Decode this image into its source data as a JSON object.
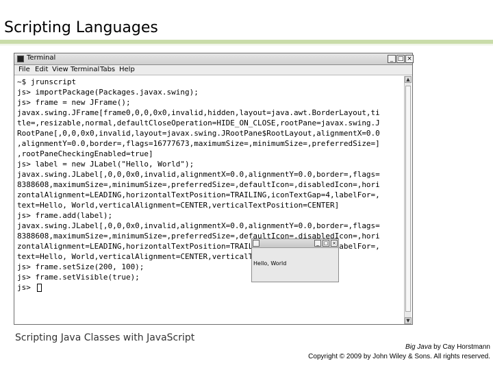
{
  "slide": {
    "title": "Scripting Languages",
    "caption": "Scripting Java Classes with JavaScript",
    "credit_book": "Big Java",
    "credit_author": " by Cay Horstmann",
    "copyright": "Copyright © 2009 by John Wiley & Sons. All rights reserved."
  },
  "terminal": {
    "title": "Terminal",
    "controls": {
      "minimize": "_",
      "maximize": "□",
      "close": "×"
    },
    "menu": [
      "File",
      "Edit",
      "View",
      "Terminal",
      "Tabs",
      "Help"
    ],
    "lines": [
      "~$ jrunscript",
      "js> importPackage(Packages.javax.swing);",
      "js> frame = new JFrame();",
      "javax.swing.JFrame[frame0,0,0,0x0,invalid,hidden,layout=java.awt.BorderLayout,ti",
      "tle=,resizable,normal,defaultCloseOperation=HIDE_ON_CLOSE,rootPane=javax.swing.J",
      "RootPane[,0,0,0x0,invalid,layout=javax.swing.JRootPane$RootLayout,alignmentX=0.0",
      ",alignmentY=0.0,border=,flags=16777673,maximumSize=,minimumSize=,preferredSize=]",
      ",rootPaneCheckingEnabled=true]",
      "js> label = new JLabel(\"Hello, World\");",
      "javax.swing.JLabel[,0,0,0x0,invalid,alignmentX=0.0,alignmentY=0.0,border=,flags=",
      "8388608,maximumSize=,minimumSize=,preferredSize=,defaultIcon=,disabledIcon=,hori",
      "zontalAlignment=LEADING,horizontalTextPosition=TRAILING,iconTextGap=4,labelFor=,",
      "text=Hello, World,verticalAlignment=CENTER,verticalTextPosition=CENTER]",
      "js> frame.add(label);",
      "javax.swing.JLabel[,0,0,0x0,invalid,alignmentX=0.0,alignmentY=0.0,border=,flags=",
      "8388608,maximumSize=,minimumSize=,preferredSize=,defaultIcon=,disabledIcon=,hori",
      "zontalAlignment=LEADING,horizontalTextPosition=TRAILING,iconTextGap=4,labelFor=,",
      "text=Hello, World,verticalAlignment=CENTER,verticalTextPosition=CENTER]",
      "js> frame.setSize(200, 100);",
      "js> frame.setVisible(true);",
      "js> "
    ]
  },
  "swing_window": {
    "label": "Hello, World",
    "controls": {
      "minimize": "_",
      "maximize": "□",
      "close": "×"
    }
  }
}
